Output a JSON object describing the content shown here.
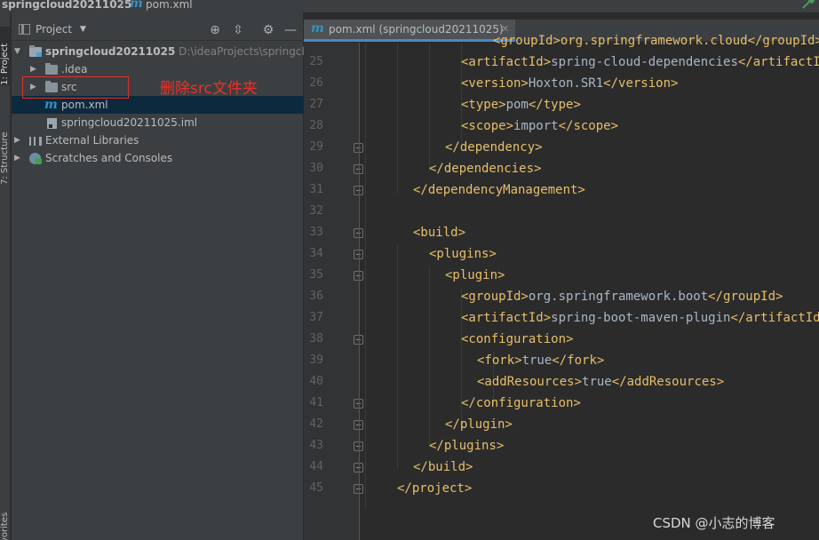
{
  "navbar": {
    "project": "springcloud20211025",
    "separator": "〉",
    "file_icon": "m",
    "file": "pom.xml",
    "build_icon": "hammer-icon"
  },
  "tool_strip": {
    "project_tab": "1: Project",
    "structure_tab": "7: Structure",
    "favorites_tab": "Favorites"
  },
  "project_panel": {
    "title": "Project",
    "tree": [
      {
        "name": "springcloud20211025",
        "path": "D:\\ideaProjects\\springclou",
        "type": "root-folder",
        "expanded": true
      },
      {
        "name": ".idea",
        "type": "folder"
      },
      {
        "name": "src",
        "type": "folder"
      },
      {
        "name": "pom.xml",
        "type": "maven-file",
        "selected": true
      },
      {
        "name": "springcloud20211025.iml",
        "type": "iml-file"
      },
      {
        "name": "External Libraries",
        "type": "libraries"
      },
      {
        "name": "Scratches and Consoles",
        "type": "scratches"
      }
    ]
  },
  "annotation": {
    "text": "删除src文件夹",
    "color": "#e0312d"
  },
  "editor": {
    "tab_label": "pom.xml (springcloud20211025)",
    "tab_icon": "m",
    "top_partial": "<groupId>org.springframework.cloud</groupId>",
    "lines": [
      {
        "num": "25",
        "text": "<artifactId>spring-cloud-dependencies</artifactId>"
      },
      {
        "num": "26",
        "text": "<version>Hoxton.SR1</version>"
      },
      {
        "num": "27",
        "text": "<type>pom</type>"
      },
      {
        "num": "28",
        "text": "<scope>import</scope>"
      },
      {
        "num": "29",
        "text": "</dependency>"
      },
      {
        "num": "30",
        "text": "</dependencies>"
      },
      {
        "num": "31",
        "text": "</dependencyManagement>"
      },
      {
        "num": "32",
        "text": ""
      },
      {
        "num": "33",
        "text": "<build>"
      },
      {
        "num": "34",
        "text": "<plugins>"
      },
      {
        "num": "35",
        "text": "<plugin>"
      },
      {
        "num": "36",
        "text": "<groupId>org.springframework.boot</groupId>"
      },
      {
        "num": "37",
        "text": "<artifactId>spring-boot-maven-plugin</artifactId>"
      },
      {
        "num": "38",
        "text": "<configuration>"
      },
      {
        "num": "39",
        "text": "<fork>true</fork>"
      },
      {
        "num": "40",
        "text": "<addResources>true</addResources>"
      },
      {
        "num": "41",
        "text": "</configuration>"
      },
      {
        "num": "42",
        "text": "</plugin>"
      },
      {
        "num": "43",
        "text": "</plugins>"
      },
      {
        "num": "44",
        "text": "</build>"
      },
      {
        "num": "45",
        "text": "</project>"
      }
    ]
  },
  "watermark": "CSDN @小志的博客"
}
